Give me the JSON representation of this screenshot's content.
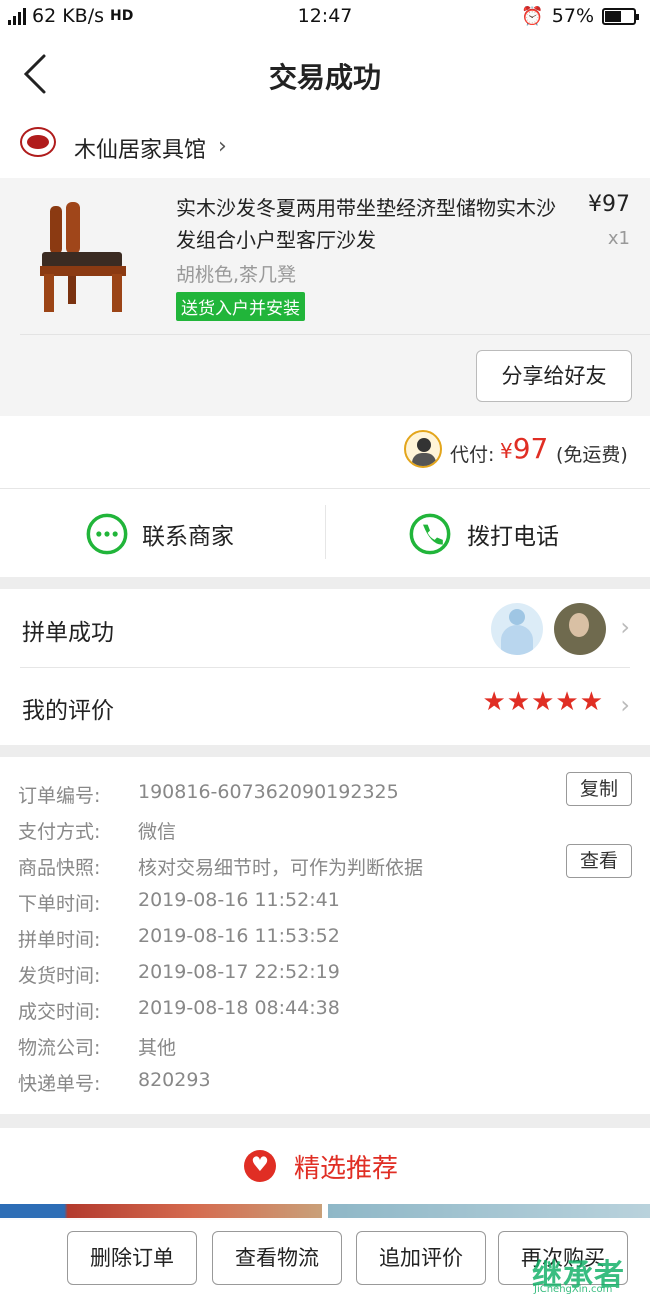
{
  "status": {
    "network": "4G",
    "speed": "62 KB/s",
    "hd": "HD",
    "time": "12:47",
    "battery": "57%",
    "battery_level": 0.57
  },
  "header": {
    "title": "交易成功"
  },
  "shop": {
    "name": "木仙居家具馆"
  },
  "product": {
    "title": "实木沙发冬夏两用带坐垫经济型储物实木沙发组合小户型客厅沙发",
    "price": "¥97",
    "qty": "x1",
    "spec": "胡桃色,茶几凳",
    "tag": "送货入户并安装",
    "share_label": "分享给好友"
  },
  "payment": {
    "label": "代付:",
    "currency": "¥",
    "amount": "97",
    "shipping": "(免运费)"
  },
  "contact": {
    "merchant_label": "联系商家",
    "call_label": "拨打电话"
  },
  "group_buy": {
    "label": "拼单成功"
  },
  "review": {
    "label": "我的评价",
    "stars": "★★★★★",
    "rating": 5
  },
  "order_details": {
    "rows": [
      {
        "key": "订单编号:",
        "value": "190816-607362090192325",
        "action": "复制"
      },
      {
        "key": "支付方式:",
        "value": "微信"
      },
      {
        "key": "商品快照:",
        "value": "核对交易细节时，可作为判断依据",
        "action": "查看"
      },
      {
        "key": "下单时间:",
        "value": "2019-08-16 11:52:41"
      },
      {
        "key": "拼单时间:",
        "value": "2019-08-16 11:53:52"
      },
      {
        "key": "发货时间:",
        "value": "2019-08-17 22:52:19"
      },
      {
        "key": "成交时间:",
        "value": "2019-08-18 08:44:38"
      },
      {
        "key": "物流公司:",
        "value": "其他"
      },
      {
        "key": "快递单号:",
        "value": "820293"
      }
    ]
  },
  "recommend": {
    "label": "精选推荐"
  },
  "actions": {
    "delete": "删除订单",
    "logistics": "查看物流",
    "add_review": "追加评价",
    "rebuy": "再次购买"
  },
  "watermark": {
    "logo": "继承者",
    "url": "JiChengXin.com"
  },
  "colors": {
    "accent_red": "#e02e24",
    "accent_green": "#21b53a"
  }
}
